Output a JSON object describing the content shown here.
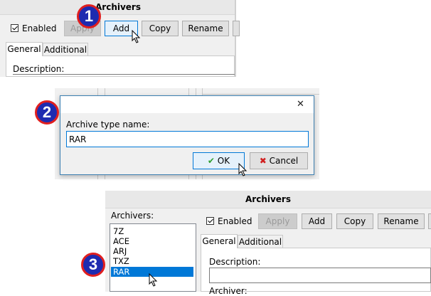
{
  "panel1": {
    "title": "Archivers",
    "enabled_label": "Enabled",
    "apply_label": "Apply",
    "add_label": "Add",
    "copy_label": "Copy",
    "rename_label": "Rename",
    "tabs": [
      "General",
      "Additional"
    ],
    "description_label": "Description:"
  },
  "dialog": {
    "label": "Archive type name:",
    "value": "RAR",
    "ok_label": "OK",
    "cancel_label": "Cancel",
    "close_symbol": "✕"
  },
  "panel3": {
    "title": "Archivers",
    "list_label": "Archivers:",
    "list_items": [
      "7Z",
      "ACE",
      "ARJ",
      "TXZ",
      "RAR"
    ],
    "selected_item": "RAR",
    "enabled_label": "Enabled",
    "apply_label": "Apply",
    "add_label": "Add",
    "copy_label": "Copy",
    "rename_label": "Rename",
    "tabs": [
      "General",
      "Additional"
    ],
    "description_label": "Description:",
    "archiver_label": "Archiver:"
  },
  "steps": [
    "1",
    "2",
    "3"
  ],
  "colors": {
    "badge_fill": "#1e2bb0",
    "badge_border": "#e01f1f",
    "selection": "#0078d7"
  },
  "icons": {
    "ok": "checkmark-icon",
    "cancel": "x-icon",
    "pointer": "mouse-pointer-icon"
  }
}
